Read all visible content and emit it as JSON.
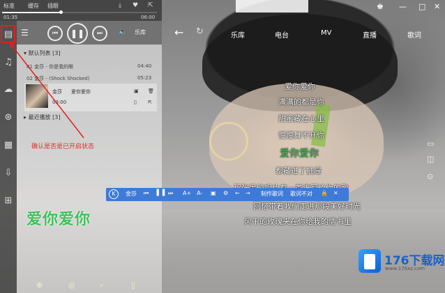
{
  "topbar": {
    "labels": [
      "标准",
      "缓存",
      "插眼"
    ],
    "time_current": "01:35",
    "time_total": "06:00",
    "progress": 0.38
  },
  "left_icons": [
    "list-icon",
    "music-note-icon",
    "cloud-icon",
    "radio-icon",
    "playlist-icon",
    "download-icon",
    "apps-icon"
  ],
  "controls": {
    "volume_icon": "volume-icon",
    "mode_label": "乐库"
  },
  "playlist": {
    "header": "默认列表",
    "header_count": "[3]",
    "rows": [
      {
        "title": "01 金莎 - 你是我的眼",
        "duration": "04:40"
      },
      {
        "title": "02 金莎 - (Shock Shocked)",
        "duration": "05:23"
      }
    ],
    "now_title": "金莎",
    "now_sub": "爱你爱你",
    "now_time": "03:00",
    "recent_header": "最近播放",
    "recent_count": "[3]"
  },
  "annotation": "确认是否是已开启状态",
  "big_karaoke": "爱你爱你",
  "nav": {
    "items": [
      "乐库",
      "电台",
      "MV",
      "直播",
      "歌词"
    ]
  },
  "lyrics": [
    {
      "text": "爱你爱你",
      "highlight": false
    },
    {
      "text": "满满的都是你",
      "highlight": false
    },
    {
      "text": "甜蜜藏在心里",
      "highlight": false
    },
    {
      "text": "慢慢舞不开你",
      "highlight": false
    },
    {
      "text": "爱你爱你",
      "highlight": true
    },
    {
      "text": "都藏进了抽屉",
      "highlight": false
    },
    {
      "text": "那张黑胶唱片有一首谁写给你的歌",
      "highlight": false
    },
    {
      "text": "回忆带着我们走进那段美好时光",
      "highlight": false
    },
    {
      "text": "风干的玫瑰夹在你给我的情书里",
      "highlight": false
    }
  ],
  "karaoke_bar": {
    "logo": "K",
    "items": [
      "金莎",
      "字体",
      "制作歌词",
      "歌词不对"
    ]
  },
  "watermark": {
    "name": "176下载网",
    "url": "www.176xz.com"
  }
}
